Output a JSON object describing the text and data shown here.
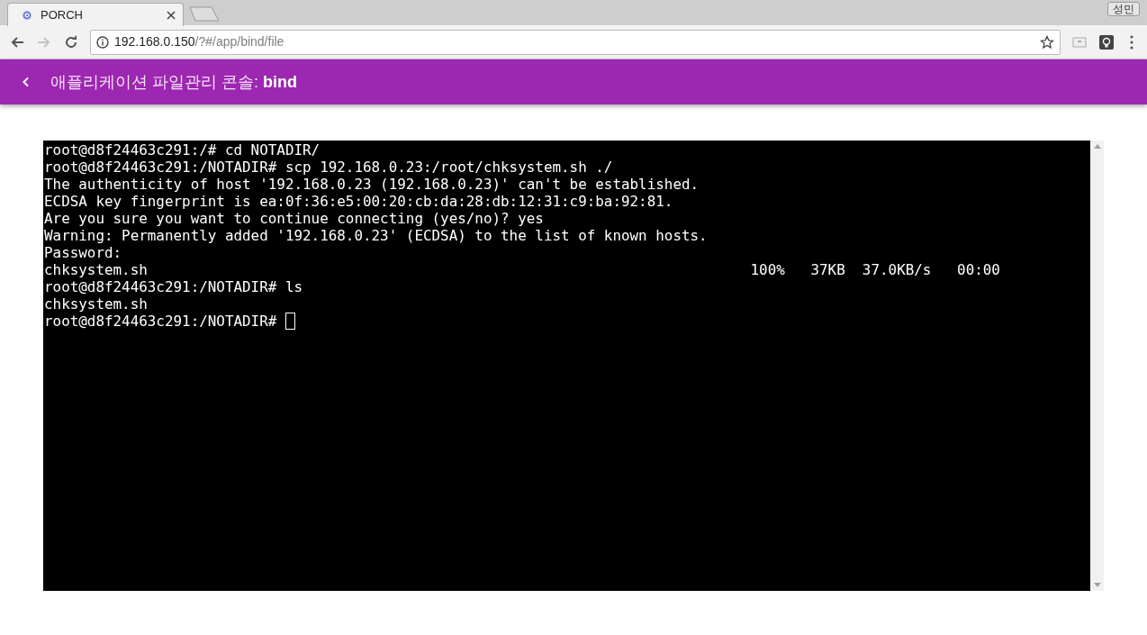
{
  "browser": {
    "tab": {
      "title": "PORCH",
      "selected": true
    },
    "profile": "성민",
    "nav": {
      "back_disabled": false,
      "forward_disabled": true
    },
    "address": {
      "host": "192.168.0.150",
      "path": "/?#/app/bind/file"
    }
  },
  "app_bar": {
    "title": "애플리케이션 파일관리 콘솔: **bind**"
  },
  "terminal": {
    "lines": [
      "root@d8f24463c291:/# cd NOTADIR/",
      "root@d8f24463c291:/NOTADIR# scp 192.168.0.23:/root/chksystem.sh ./",
      "The authenticity of host '192.168.0.23 (192.168.0.23)' can't be established.",
      "ECDSA key fingerprint is ea:0f:36:e5:00:20:cb:da:28:db:12:31:c9:ba:92:81.",
      "Are you sure you want to continue connecting (yes/no)? yes",
      "Warning: Permanently added '192.168.0.23' (ECDSA) to the list of known hosts.",
      "Password: ",
      "chksystem.sh                                                                      100%   37KB  37.0KB/s   00:00",
      "root@d8f24463c291:/NOTADIR# ls",
      "chksystem.sh",
      "root@d8f24463c291:/NOTADIR# "
    ],
    "cursor_on_last_line": true
  }
}
